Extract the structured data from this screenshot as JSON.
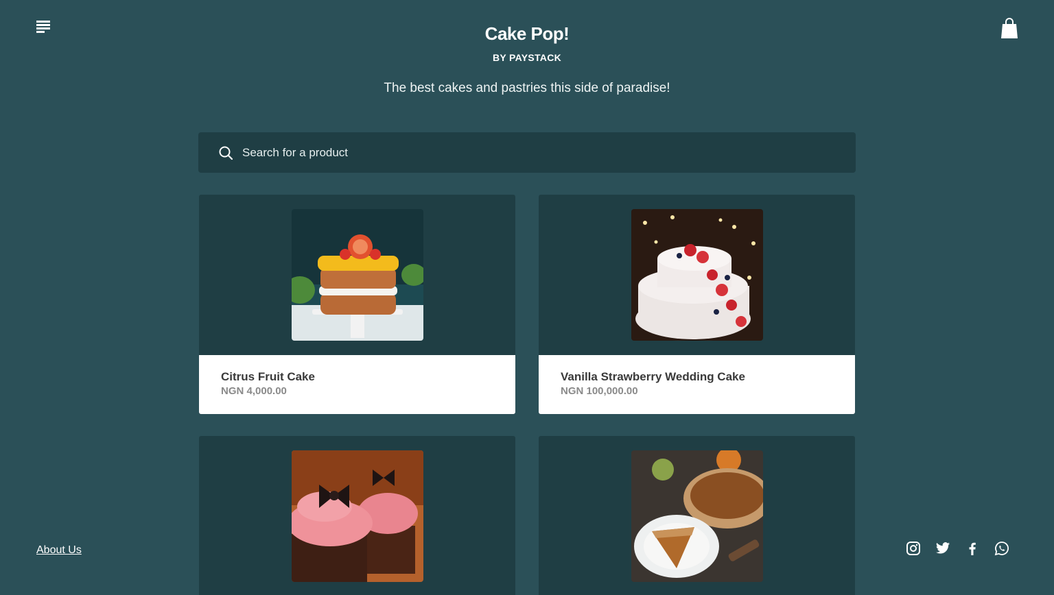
{
  "header": {
    "store_name": "Cake Pop!",
    "byline": "BY PAYSTACK",
    "tagline": "The best cakes and pastries this side of paradise!",
    "menu_icon": "menu-icon",
    "cart_icon": "shopping-bag-icon"
  },
  "search": {
    "placeholder": "Search for a product",
    "icon": "search-icon"
  },
  "products": [
    {
      "name": "Citrus Fruit Cake",
      "price": "NGN 4,000.00",
      "image": "citrus-cake-photo"
    },
    {
      "name": "Vanilla Strawberry Wedding Cake",
      "price": "NGN 100,000.00",
      "image": "wedding-cake-photo"
    },
    {
      "name": "",
      "price": "",
      "image": "cupcake-photo"
    },
    {
      "name": "",
      "price": "",
      "image": "pie-photo"
    }
  ],
  "footer": {
    "about_label": "About Us",
    "socials": [
      "instagram-icon",
      "twitter-icon",
      "facebook-icon",
      "whatsapp-icon"
    ]
  },
  "colors": {
    "background": "#2b5058",
    "card_dark": "#1f3e44",
    "text": "#ffffff"
  }
}
